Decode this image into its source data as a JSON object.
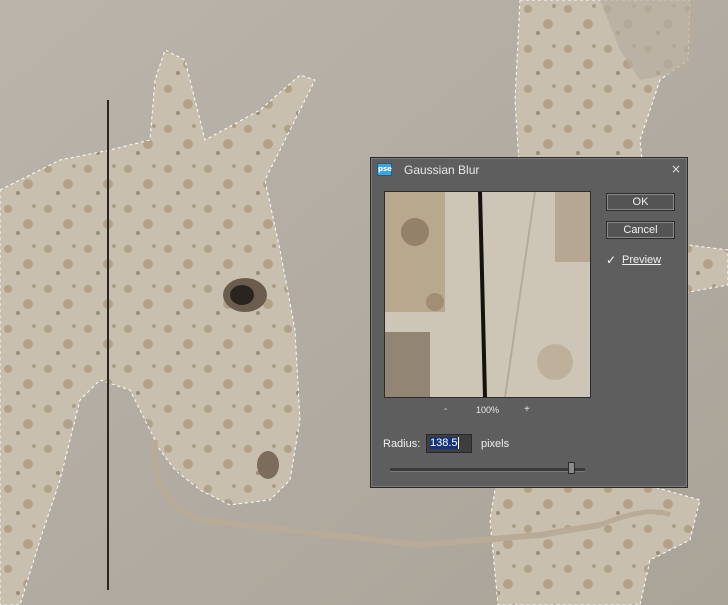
{
  "dialog": {
    "app_icon": "pse",
    "title": "Gaussian Blur",
    "close_glyph": "×",
    "zoom": {
      "minus": "-",
      "percent": "100%",
      "plus": "+"
    },
    "ok_label": "OK",
    "cancel_label": "Cancel",
    "preview": {
      "checked": true,
      "check_glyph": "✓",
      "label": "Preview"
    },
    "radius": {
      "label": "Radius:",
      "value": "138.5",
      "unit": "pixels"
    }
  },
  "colors": {
    "dialog_bg": "#5e5e5e",
    "canvas_bg": "#b5afa6",
    "selection_highlight": "#16337a"
  },
  "icons": [
    "app-icon",
    "close-icon",
    "checkmark-icon",
    "slider-thumb"
  ]
}
